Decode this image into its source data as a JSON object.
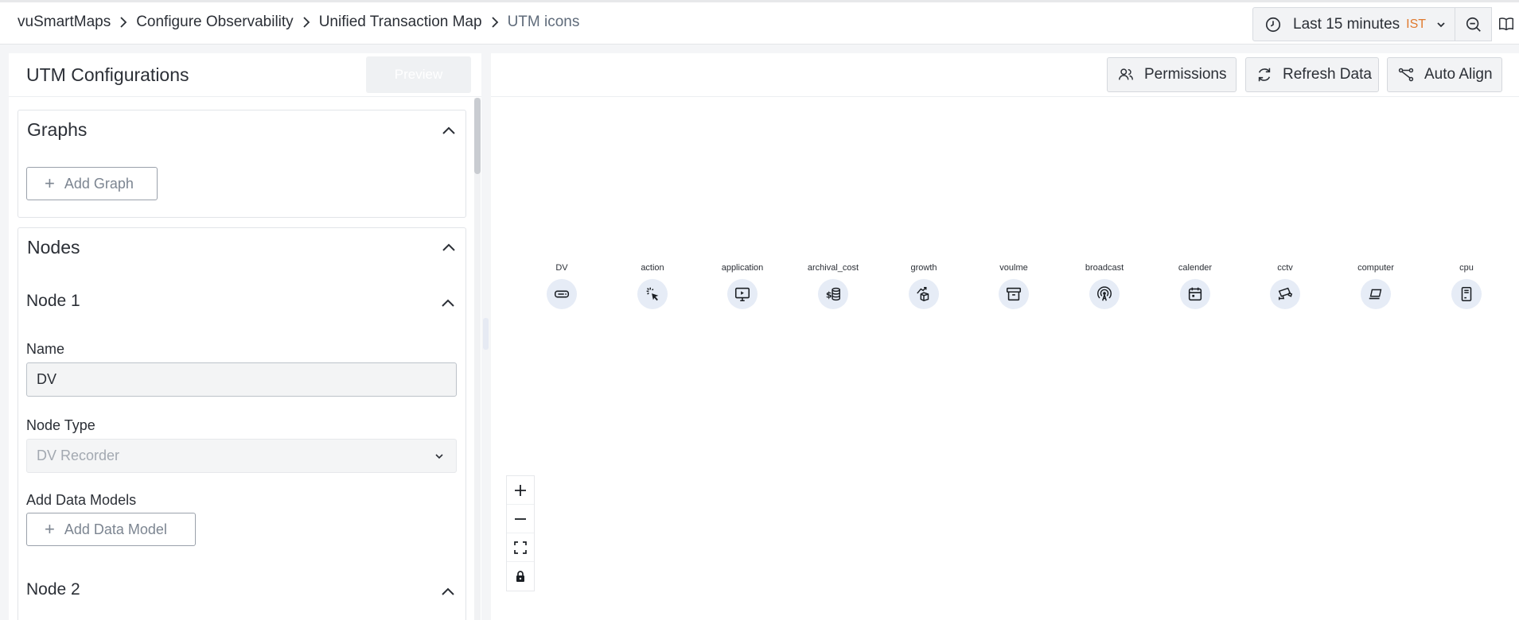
{
  "breadcrumb": {
    "items": [
      "vuSmartMaps",
      "Configure Observability",
      "Unified Transaction Map",
      "UTM icons"
    ]
  },
  "time_picker": {
    "label": "Last 15 minutes",
    "timezone": "IST",
    "icon": "clock-icon"
  },
  "colors": {
    "timezone": "#e07a2f",
    "node_circle": "#e6ecf6",
    "border": "#d8dbe0"
  },
  "left_panel": {
    "title": "UTM Configurations",
    "preview_label": "Preview",
    "graphs": {
      "title": "Graphs",
      "add_graph_label": "Add Graph"
    },
    "nodes": {
      "title": "Nodes",
      "node1": {
        "title": "Node 1",
        "name_label": "Name",
        "name_value": "DV",
        "node_type_label": "Node Type",
        "node_type_value": "DV Recorder",
        "data_models_label": "Add Data Models",
        "add_data_model_label": "Add Data Model"
      },
      "node2": {
        "title": "Node 2"
      }
    }
  },
  "toolbar": {
    "permissions_label": "Permissions",
    "refresh_label": "Refresh Data",
    "auto_align_label": "Auto Align"
  },
  "canvas": {
    "nodes": [
      {
        "label": "DV",
        "icon": "dv-recorder-icon"
      },
      {
        "label": "action",
        "icon": "cursor-click-icon"
      },
      {
        "label": "application",
        "icon": "monitor-app-icon"
      },
      {
        "label": "archival_cost",
        "icon": "dollar-coins-icon"
      },
      {
        "label": "growth",
        "icon": "growth-box-icon"
      },
      {
        "label": "voulme",
        "icon": "archive-box-icon"
      },
      {
        "label": "broadcast",
        "icon": "broadcast-icon"
      },
      {
        "label": "calender",
        "icon": "calendar-icon"
      },
      {
        "label": "cctv",
        "icon": "cctv-icon"
      },
      {
        "label": "computer",
        "icon": "laptop-icon"
      },
      {
        "label": "cpu",
        "icon": "cpu-icon"
      }
    ],
    "controls": [
      "zoom-in-icon",
      "zoom-out-icon",
      "fit-view-icon",
      "lock-icon"
    ]
  }
}
